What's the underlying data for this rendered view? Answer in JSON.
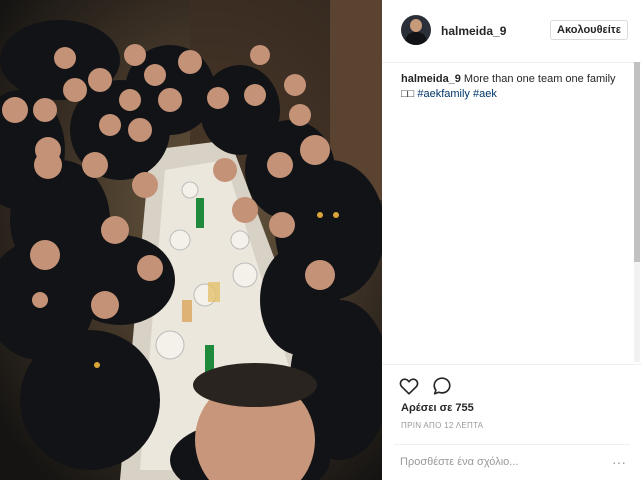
{
  "post": {
    "photo_alt": "Team dinner selfie",
    "username": "halmeida_9",
    "follow_label": "Ακολουθείτε",
    "caption_text": "More than one team one family □□",
    "hashtags": [
      "#aekfamily",
      "#aek"
    ],
    "likes_text": "Αρέσει σε 755",
    "time_text": "ΠΡΙΝ ΑΠΟ 12 ΛΕΠΤΑ",
    "comment_placeholder": "Προσθέστε ένα σχόλιο...",
    "more_symbol": "···"
  },
  "icons": {
    "like": "heart-icon",
    "comment": "comment-icon",
    "more": "more-options-icon"
  },
  "colors": {
    "link": "#003569",
    "text": "#262626",
    "muted": "#999999",
    "border": "#dbdbdb"
  }
}
